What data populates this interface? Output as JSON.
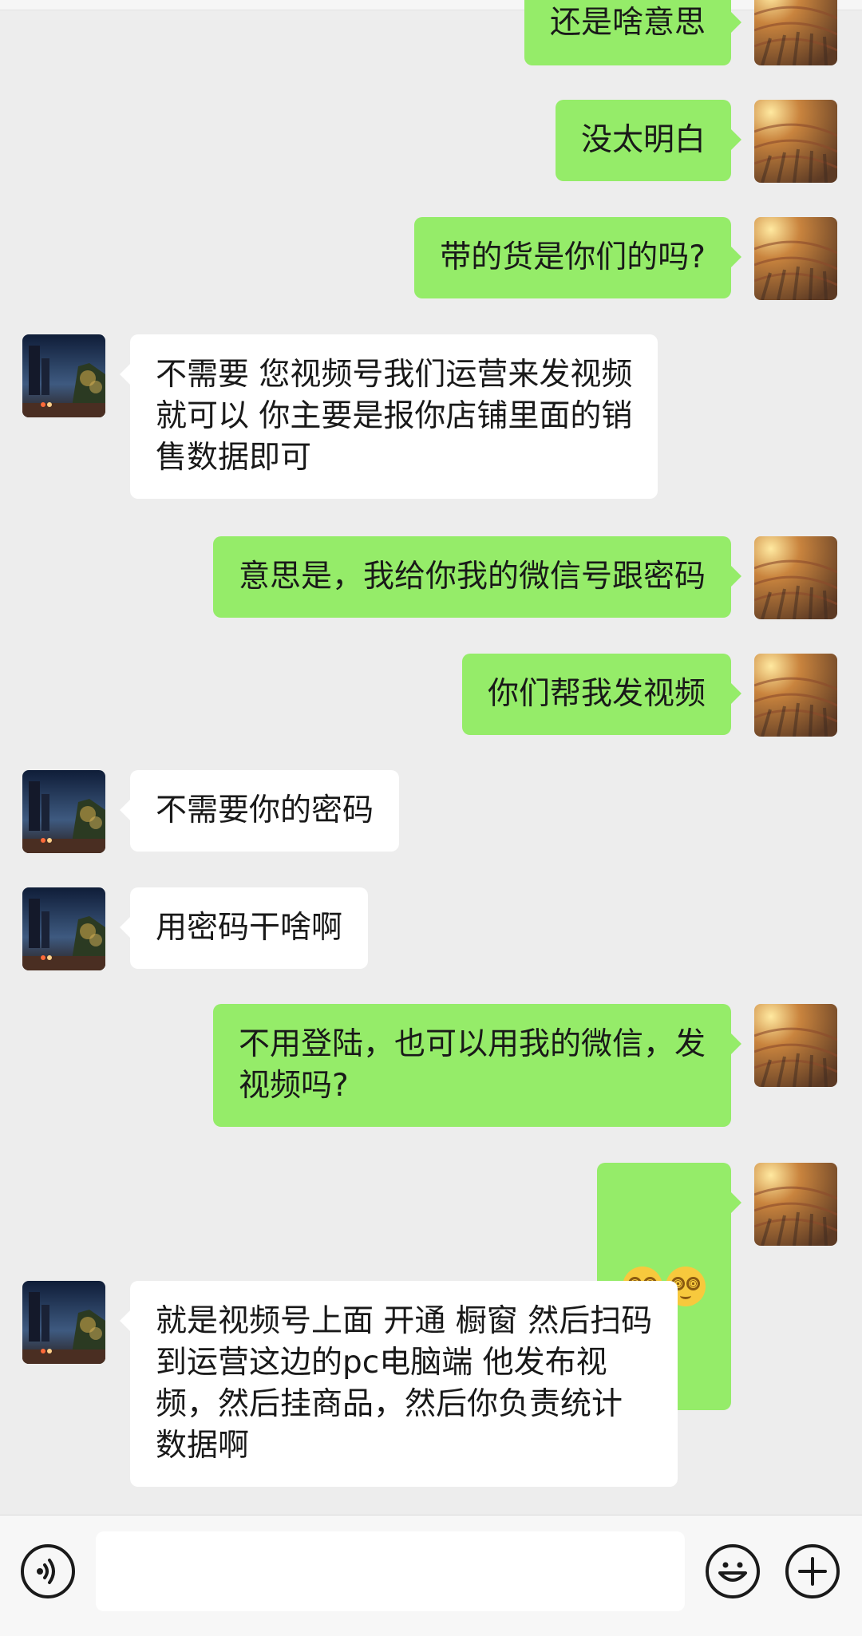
{
  "chat": {
    "messages": [
      {
        "side": "out",
        "text": "还是啥意思"
      },
      {
        "side": "out",
        "text": "没太明白"
      },
      {
        "side": "out",
        "text": "带的货是你们的吗?"
      },
      {
        "side": "in",
        "text": "不需要 您视频号我们运营来发视频\n就可以 你主要是报你店铺里面的销\n售数据即可"
      },
      {
        "side": "out",
        "text": "意思是，我给你我的微信号跟密码"
      },
      {
        "side": "out",
        "text": "你们帮我发视频"
      },
      {
        "side": "in",
        "text": "不需要你的密码"
      },
      {
        "side": "in",
        "text": "用密码干啥啊"
      },
      {
        "side": "out",
        "text": "不用登陆，也可以用我的微信，发\n视频吗?"
      },
      {
        "side": "out",
        "emoji": "dizzy-face-emoji x2"
      },
      {
        "side": "in",
        "text": "就是视频号上面 开通 橱窗 然后扫码\n到运营这边的pc电脑端 他发布视\n频，然后挂商品，然后你负责统计\n数据啊"
      }
    ]
  },
  "input": {
    "value": "",
    "placeholder": ""
  },
  "icons": {
    "voice": "voice-icon",
    "emoji": "smiley-icon",
    "more": "plus-icon"
  },
  "colors": {
    "background": "#ededed",
    "outgoing_bubble": "#95ec69",
    "incoming_bubble": "#ffffff",
    "text": "#191919"
  }
}
